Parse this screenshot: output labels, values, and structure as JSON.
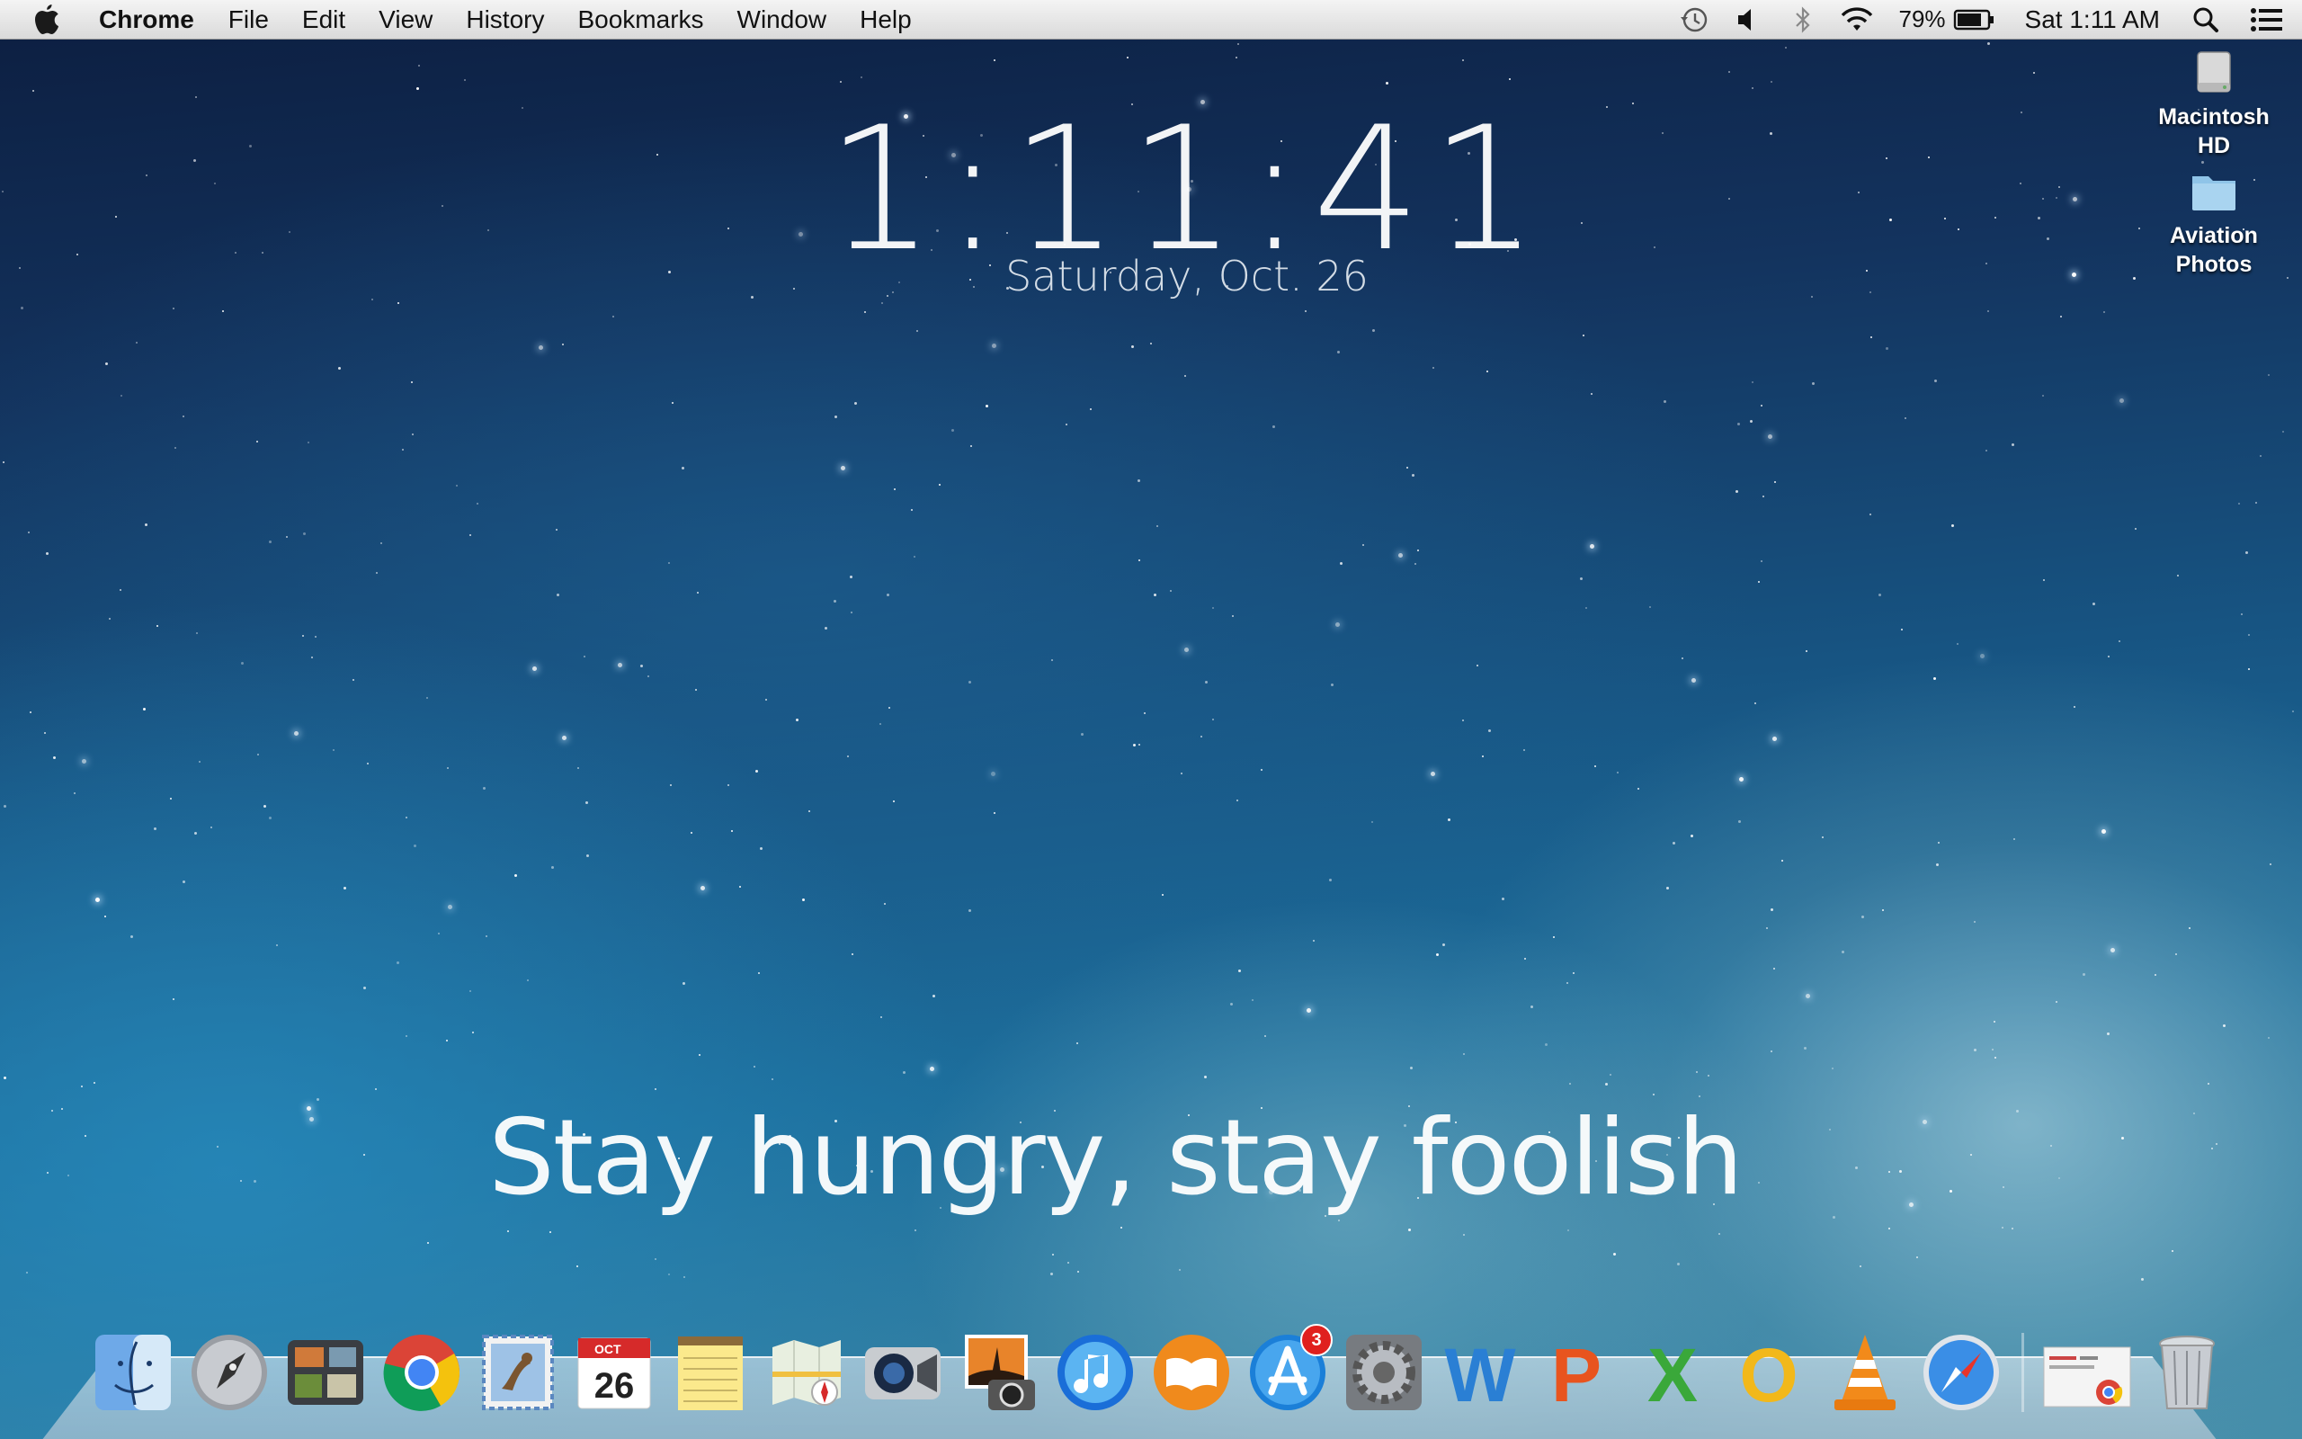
{
  "menubar": {
    "app_name": "Chrome",
    "items": [
      "File",
      "Edit",
      "View",
      "History",
      "Bookmarks",
      "Window",
      "Help"
    ],
    "status": {
      "battery_percent": "79%",
      "clock": "Sat 1:11 AM"
    }
  },
  "widget": {
    "time": "1:11:41",
    "date": "Saturday, Oct. 26",
    "quote": "Stay hungry, stay foolish"
  },
  "desktop_icons": [
    {
      "label_line1": "Macintosh",
      "label_line2": "HD",
      "icon": "hard-drive-icon"
    },
    {
      "label_line1": "Aviation",
      "label_line2": "Photos",
      "icon": "folder-icon"
    }
  ],
  "dock": {
    "apps": [
      {
        "name": "Finder",
        "icon": "finder-icon"
      },
      {
        "name": "Launchpad",
        "icon": "launchpad-icon"
      },
      {
        "name": "Mission Control",
        "icon": "mission-control-icon"
      },
      {
        "name": "Chrome",
        "icon": "chrome-icon"
      },
      {
        "name": "Mail",
        "icon": "mail-icon"
      },
      {
        "name": "Calendar",
        "icon": "calendar-icon",
        "calendar_month": "OCT",
        "calendar_day": "26"
      },
      {
        "name": "Notes",
        "icon": "notes-icon"
      },
      {
        "name": "Maps",
        "icon": "maps-icon"
      },
      {
        "name": "FaceTime",
        "icon": "facetime-icon"
      },
      {
        "name": "iPhoto",
        "icon": "iphoto-icon"
      },
      {
        "name": "iTunes",
        "icon": "itunes-icon"
      },
      {
        "name": "iBooks",
        "icon": "ibooks-icon"
      },
      {
        "name": "App Store",
        "icon": "app-store-icon",
        "badge": "3"
      },
      {
        "name": "System Preferences",
        "icon": "system-preferences-icon"
      },
      {
        "name": "Word",
        "icon": "word-icon",
        "letter": "W"
      },
      {
        "name": "PowerPoint",
        "icon": "powerpoint-icon",
        "letter": "P"
      },
      {
        "name": "Excel",
        "icon": "excel-icon",
        "letter": "X"
      },
      {
        "name": "Outlook",
        "icon": "outlook-icon",
        "letter": "O"
      },
      {
        "name": "VLC",
        "icon": "vlc-icon"
      },
      {
        "name": "Safari",
        "icon": "safari-icon"
      }
    ],
    "stack": {
      "name": "Downloads",
      "icon": "downloads-stack-icon"
    },
    "trash": {
      "name": "Trash",
      "icon": "trash-icon"
    }
  },
  "colors": {
    "menubar": "#e6e6e6",
    "sky_top": "#0c1e40",
    "sky_bottom": "#3e8aa8",
    "badge": "#e0201e"
  }
}
